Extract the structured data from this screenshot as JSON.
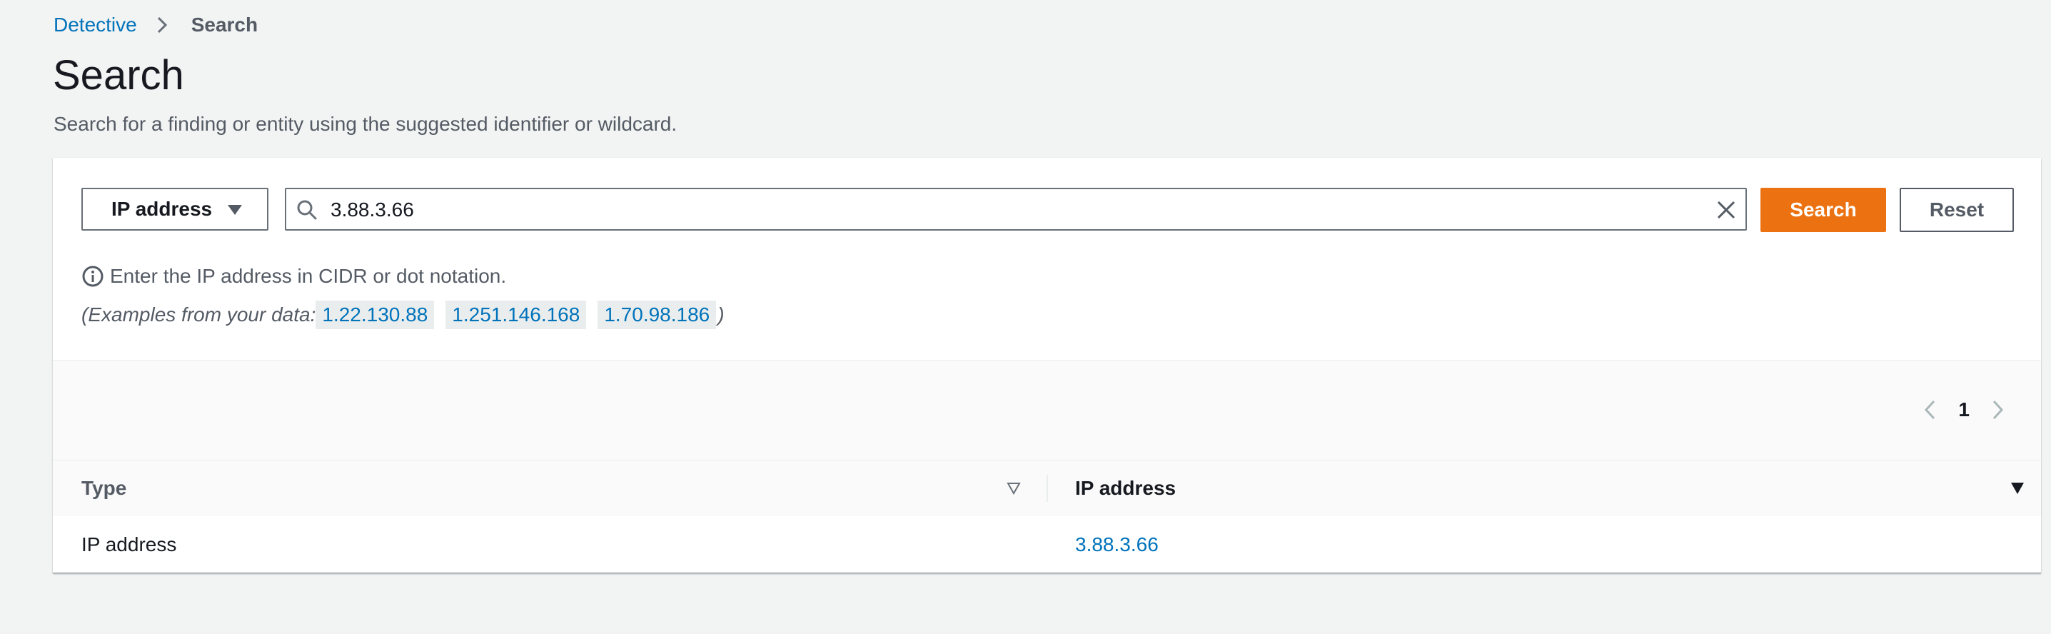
{
  "breadcrumb": {
    "root": "Detective",
    "current": "Search"
  },
  "page": {
    "title": "Search",
    "description": "Search for a finding or entity using the suggested identifier or wildcard."
  },
  "search": {
    "type_selected": "IP address",
    "query_value": "3.88.3.66",
    "search_button": "Search",
    "reset_button": "Reset",
    "hint": "Enter the IP address in CIDR or dot notation.",
    "examples_prefix": "(Examples from your data:",
    "examples_suffix": ")",
    "examples": [
      "1.22.130.88",
      "1.251.146.168",
      "1.70.98.186"
    ]
  },
  "pagination": {
    "current_page": "1"
  },
  "table": {
    "columns": [
      "Type",
      "IP address"
    ],
    "rows": [
      {
        "type": "IP address",
        "ip": "3.88.3.66"
      }
    ]
  },
  "colors": {
    "primary_button": "#ec7211",
    "link": "#0073bb",
    "background": "#f2f3f3"
  }
}
